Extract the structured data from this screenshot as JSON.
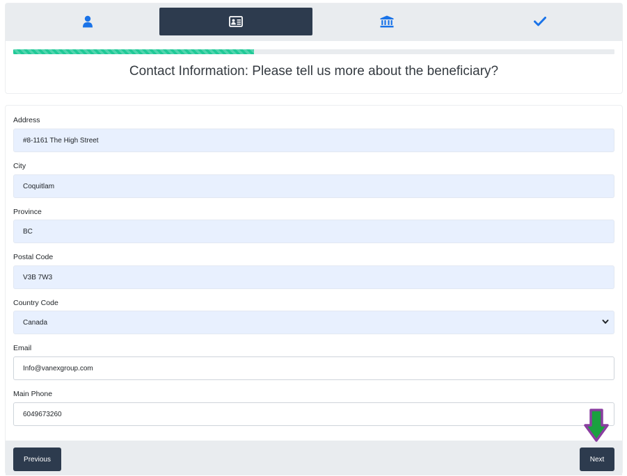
{
  "steps": [
    {
      "icon": "user-icon",
      "active": false
    },
    {
      "icon": "id-card-icon",
      "active": true
    },
    {
      "icon": "bank-icon",
      "active": false
    },
    {
      "icon": "check-icon",
      "active": false
    }
  ],
  "progress": 0.4,
  "colors": {
    "dark": "#2d3b4e",
    "blue": "#1a73e8",
    "progress": "#20c997",
    "autofill": "#e8f0fe",
    "arrow_green": "#1aa13f",
    "arrow_purple": "#8a3ea0"
  },
  "heading": "Contact Information: Please tell us more about the beneficiary?",
  "form": {
    "address": {
      "label": "Address",
      "value": "#8-1161 The High Street"
    },
    "city": {
      "label": "City",
      "value": "Coquitlam"
    },
    "province": {
      "label": "Province",
      "value": "BC"
    },
    "postal_code": {
      "label": "Postal Code",
      "value": "V3B 7W3"
    },
    "country_code": {
      "label": "Country Code",
      "value": "Canada"
    },
    "email": {
      "label": "Email",
      "value": "Info@vanexgroup.com"
    },
    "main_phone": {
      "label": "Main Phone",
      "value": "6049673260"
    }
  },
  "buttons": {
    "previous": "Previous",
    "next": "Next"
  },
  "annotation_icon": "down-arrow-icon"
}
